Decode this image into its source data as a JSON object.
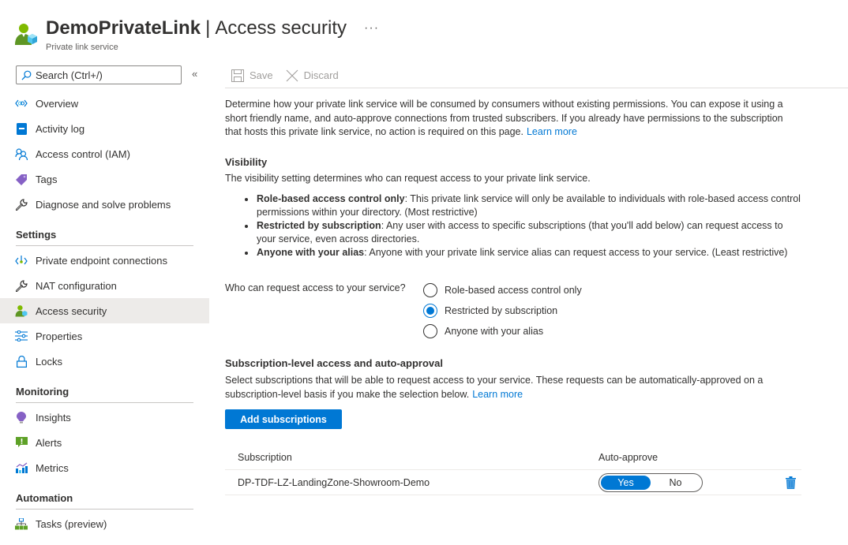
{
  "header": {
    "resource_name": "DemoPrivateLink",
    "separator": "|",
    "section": "Access security",
    "more": "···",
    "subtitle": "Private link service"
  },
  "search": {
    "placeholder": "Search (Ctrl+/)",
    "value": "",
    "collapse": "«"
  },
  "toolbar": {
    "save_label": "Save",
    "discard_label": "Discard"
  },
  "sidebar": {
    "top_items": [
      {
        "label": "Overview",
        "icon": "overview-icon"
      },
      {
        "label": "Activity log",
        "icon": "activity-log-icon"
      },
      {
        "label": "Access control (IAM)",
        "icon": "iam-icon"
      },
      {
        "label": "Tags",
        "icon": "tag-icon"
      },
      {
        "label": "Diagnose and solve problems",
        "icon": "wrench-icon"
      }
    ],
    "groups": [
      {
        "title": "Settings",
        "items": [
          {
            "label": "Private endpoint connections",
            "icon": "private-endpoint-icon"
          },
          {
            "label": "NAT configuration",
            "icon": "wrench-icon"
          },
          {
            "label": "Access security",
            "icon": "access-security-icon",
            "active": true
          },
          {
            "label": "Properties",
            "icon": "properties-icon"
          },
          {
            "label": "Locks",
            "icon": "lock-icon"
          }
        ]
      },
      {
        "title": "Monitoring",
        "items": [
          {
            "label": "Insights",
            "icon": "insights-icon"
          },
          {
            "label": "Alerts",
            "icon": "alerts-icon"
          },
          {
            "label": "Metrics",
            "icon": "metrics-icon"
          }
        ]
      },
      {
        "title": "Automation",
        "items": [
          {
            "label": "Tasks (preview)",
            "icon": "tasks-icon"
          }
        ]
      }
    ]
  },
  "content": {
    "intro": "Determine how your private link service will be consumed by consumers without existing permissions. You can expose it using a short friendly name, and auto-approve connections from trusted subscribers. If you already have permissions to the subscription that hosts this private link service, no action is required on this page.",
    "intro_link": "Learn more",
    "visibility": {
      "heading": "Visibility",
      "description": "The visibility setting determines who can request access to your private link service.",
      "bullets": [
        {
          "term": "Role-based access control only",
          "text": ": This private link service will only be available to individuals with role-based access control permissions within your directory. (Most restrictive)"
        },
        {
          "term": "Restricted by subscription",
          "text": ": Any user with access to specific subscriptions (that you'll add below) can request access to your service, even across directories."
        },
        {
          "term": "Anyone with your alias",
          "text": ": Anyone with your private link service alias can request access to your service. (Least restrictive)"
        }
      ],
      "question": "Who can request access to your service?",
      "options": [
        {
          "label": "Role-based access control only",
          "selected": false
        },
        {
          "label": "Restricted by subscription",
          "selected": true
        },
        {
          "label": "Anyone with your alias",
          "selected": false
        }
      ]
    },
    "subscription_access": {
      "heading": "Subscription-level access and auto-approval",
      "description": "Select subscriptions that will be able to request access to your service. These requests can be automatically-approved on a subscription-level basis if you make the selection below.",
      "link": "Learn more",
      "add_button": "Add subscriptions",
      "table": {
        "columns": [
          "Subscription",
          "Auto-approve"
        ],
        "rows": [
          {
            "subscription": "DP-TDF-LZ-LandingZone-Showroom-Demo",
            "auto_approve": "Yes",
            "toggle_options": [
              "Yes",
              "No"
            ]
          }
        ]
      }
    }
  },
  "colors": {
    "accent": "#0078d4",
    "active_bg": "#edebe9",
    "text": "#323130"
  }
}
